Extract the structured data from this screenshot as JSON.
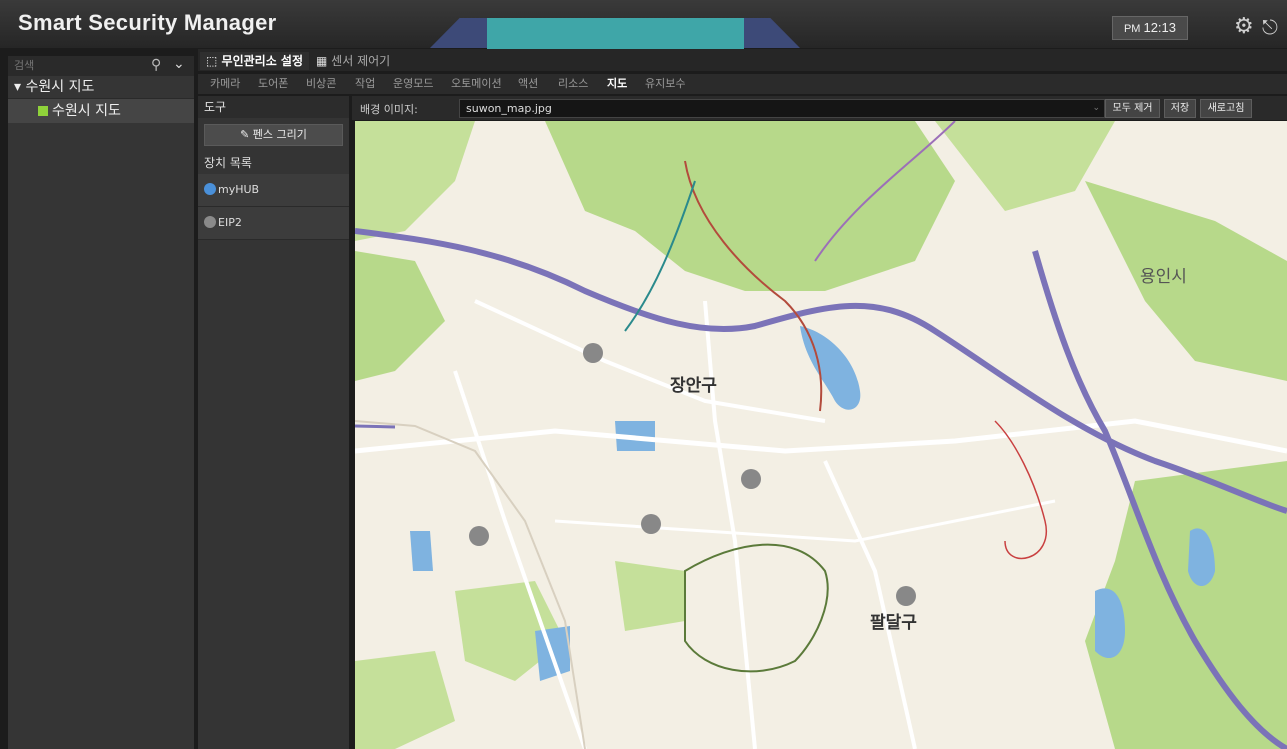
{
  "app": {
    "title": "Smart Security Manager"
  },
  "header": {
    "clock_period": "PM",
    "clock_time": "12:13"
  },
  "sidebar": {
    "search_placeholder": "검색",
    "tree_root": "수원시 지도",
    "tree_child": "수원시 지도"
  },
  "tabs": [
    {
      "label": "무인관리소 설정",
      "active": true
    },
    {
      "label": "센서 제어기",
      "active": false
    }
  ],
  "sub_tabs": [
    {
      "label": "카메라"
    },
    {
      "label": "도어폰"
    },
    {
      "label": "비상콘"
    },
    {
      "label": "작업"
    },
    {
      "label": "운영모드"
    },
    {
      "label": "오토메이션"
    },
    {
      "label": "액션"
    },
    {
      "label": "리소스"
    },
    {
      "label": "지도",
      "active": true
    },
    {
      "label": "유지보수"
    }
  ],
  "tools": {
    "header": "도구",
    "fence_button": "펜스 그리기",
    "device_list_header": "장치 목록",
    "devices": [
      {
        "name": "myHUB",
        "icon": "hub-icon",
        "color": "#4a90d9"
      },
      {
        "name": "EIP2",
        "icon": "device-icon",
        "color": "#8a8a8a"
      }
    ]
  },
  "background": {
    "label": "배경 이미지:",
    "selected": "suwon_map.jpg",
    "remove_all": "모두 제거",
    "save": "저장",
    "refresh": "새로고침"
  },
  "map": {
    "district_labels": [
      "장안구",
      "팔달구",
      "용인시"
    ],
    "colors": {
      "land": "#f3efe4",
      "park": "#b7d98a",
      "water": "#7fb3e0",
      "road": "#ffffff",
      "highway": "#7b73b8",
      "accent": "#3fa6a8"
    }
  }
}
